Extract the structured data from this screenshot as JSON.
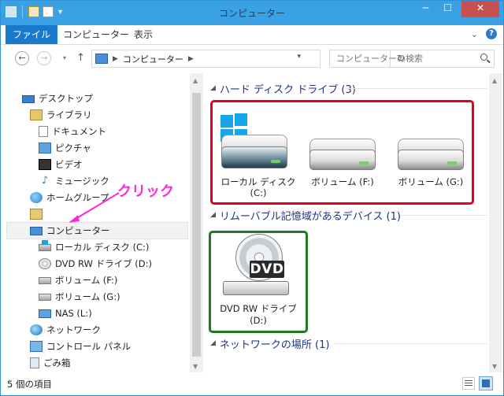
{
  "window": {
    "title": "コンピューター",
    "controls": {
      "minimize": "─",
      "maximize": "☐",
      "close": "✕"
    }
  },
  "ribbon": {
    "tabs": [
      "ファイル",
      "コンピューター",
      "表示"
    ],
    "expand_icon": "chevron-down-icon",
    "help": "?"
  },
  "address_bar": {
    "crumbs": [
      "コンピューター"
    ],
    "dropdown": "▾",
    "refresh": "↻",
    "search_placeholder": "コンピューターの検索"
  },
  "nav_pane": {
    "items": [
      {
        "label": "デスクトップ",
        "icon": "desktop-icon"
      },
      {
        "label": "ライブラリ",
        "icon": "library-icon"
      },
      {
        "label": "ドキュメント",
        "icon": "documents-icon"
      },
      {
        "label": "ピクチャ",
        "icon": "pictures-icon"
      },
      {
        "label": "ビデオ",
        "icon": "videos-icon"
      },
      {
        "label": "ミュージック",
        "icon": "music-icon"
      },
      {
        "label": "ホームグループ",
        "icon": "homegroup-icon"
      },
      {
        "label": "",
        "icon": "user-folder-icon"
      },
      {
        "label": "コンピューター",
        "icon": "computer-icon"
      },
      {
        "label": "ローカル ディスク (C:)",
        "icon": "local-disk-icon"
      },
      {
        "label": "DVD RW ドライブ (D:)",
        "icon": "dvd-drive-icon"
      },
      {
        "label": "ボリューム (F:)",
        "icon": "drive-icon"
      },
      {
        "label": "ボリューム (G:)",
        "icon": "drive-icon"
      },
      {
        "label": "NAS (L:)",
        "icon": "network-drive-icon"
      },
      {
        "label": "ネットワーク",
        "icon": "network-icon"
      },
      {
        "label": "コントロール パネル",
        "icon": "control-panel-icon"
      },
      {
        "label": "ごみ箱",
        "icon": "recycle-bin-icon"
      }
    ],
    "selected": "コンピューター"
  },
  "annotation": {
    "text": "クリック",
    "color": "#ff28d8"
  },
  "content": {
    "groups": [
      {
        "header": "ハード ディスク ドライブ (3)",
        "items": [
          {
            "label_line1": "ローカル ディスク",
            "label_line2": "(C:)"
          },
          {
            "label_line1": "ボリューム (F:)",
            "label_line2": ""
          },
          {
            "label_line1": "ボリューム (G:)",
            "label_line2": ""
          }
        ]
      },
      {
        "header": "リムーバブル記憶域があるデバイス (1)",
        "items": [
          {
            "label_line1": "DVD RW ドライブ",
            "label_line2": "(D:)",
            "disc_label": "DVD"
          }
        ]
      },
      {
        "header": "ネットワークの場所 (1)",
        "items": []
      }
    ],
    "highlight_colors": {
      "hard_disks_box": "#e00020",
      "removable_box": "#1e7a1e"
    }
  },
  "status_bar": {
    "item_count": "5 個の項目"
  },
  "colors": {
    "titlebar": "#3ba1e5",
    "file_tab": "#1979ca",
    "group_header_text": "#1e3287"
  }
}
